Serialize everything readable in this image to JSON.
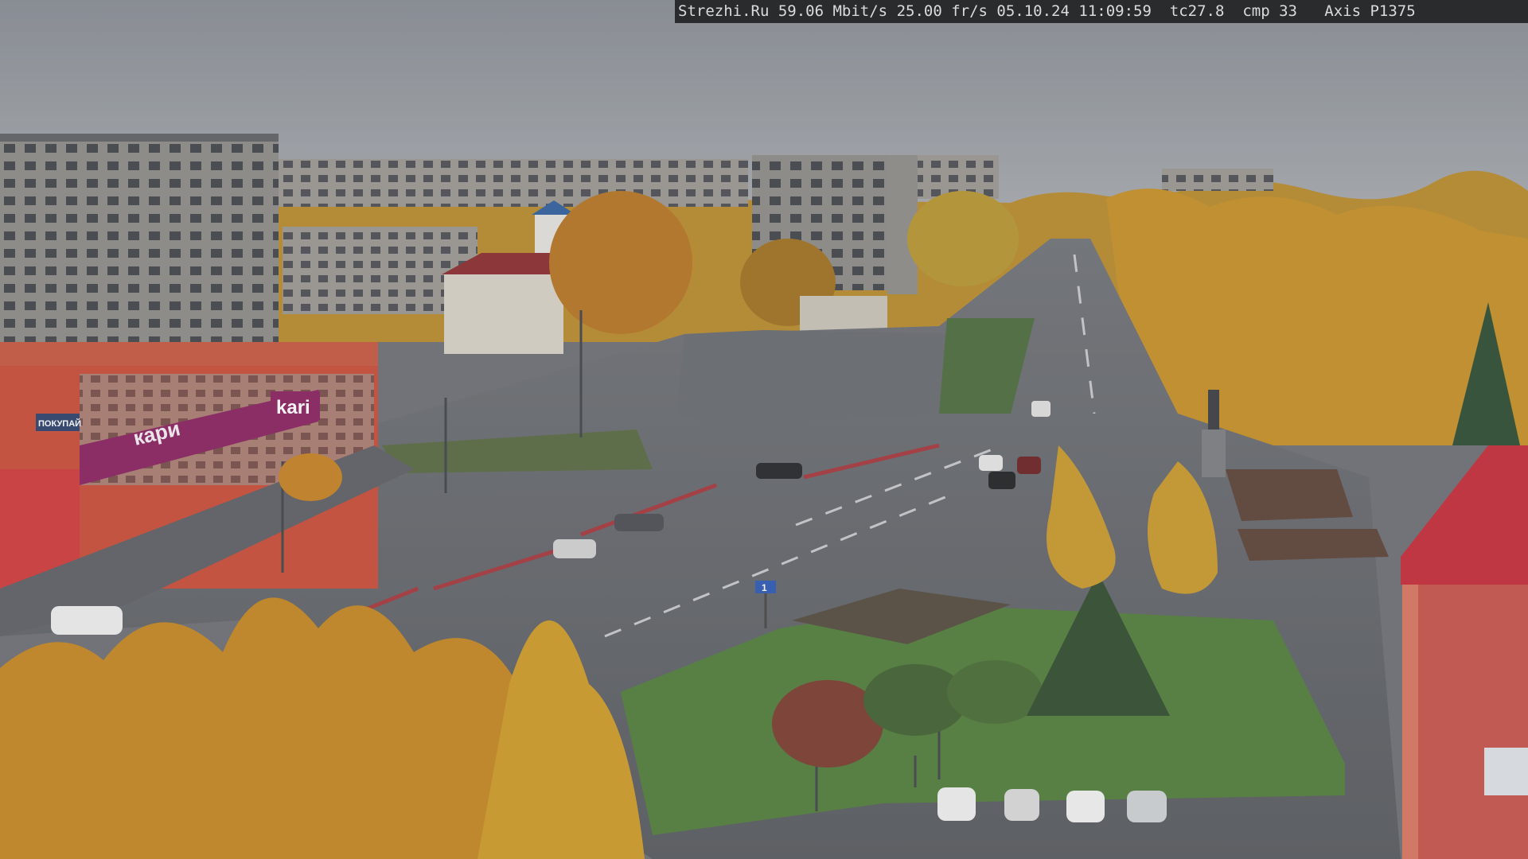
{
  "camera_overlay": {
    "site": "Strezhi.Ru",
    "bitrate": "59.06 Mbit/s",
    "framerate": "25.00 fr/s",
    "date": "05.10.24",
    "time": "11:09:59",
    "tc": "tc27.8",
    "cmp": "cmp 33",
    "camera_model": "Axis P1375"
  },
  "storefront": {
    "brand": "kari",
    "banner": "кари",
    "side_sign": "ПОКУПАЙ"
  },
  "road_sign": "1",
  "colors": {
    "sky": "#8f9499",
    "road": "#5a5d61",
    "foliage": "#c48a1c",
    "store_red": "#c84a34",
    "store_purple": "#8a1f5e"
  }
}
